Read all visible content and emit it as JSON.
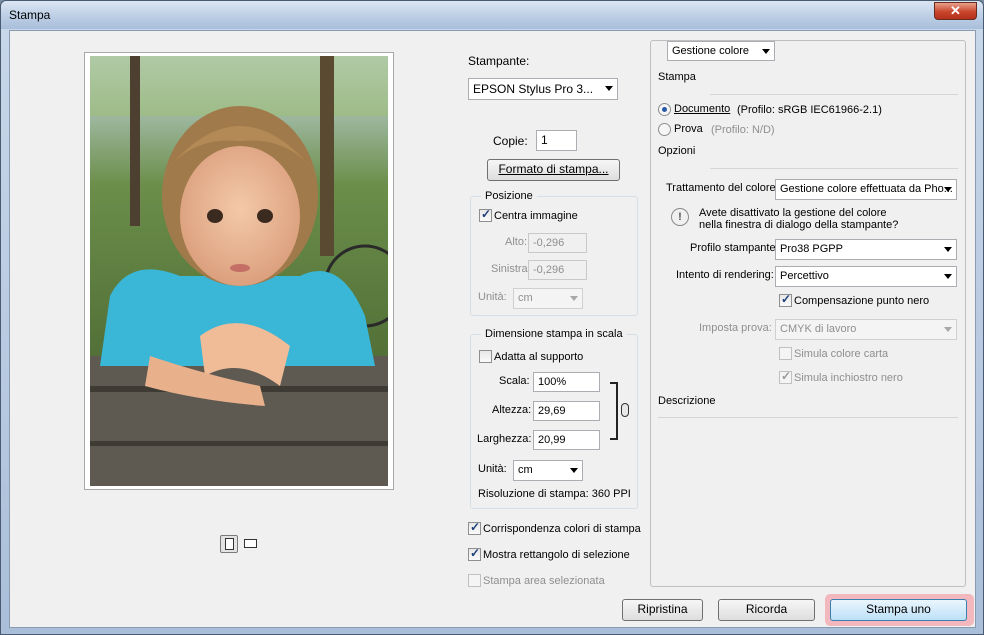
{
  "window": {
    "title": "Stampa",
    "close_glyph": "✕"
  },
  "left": {
    "orient_portrait_icon": "portrait-orientation-icon",
    "orient_landscape_icon": "landscape-orientation-icon"
  },
  "middle": {
    "printer_label": "Stampante:",
    "printer_value": "EPSON Stylus Pro 3...",
    "copies_label": "Copie:",
    "copies_value": "1",
    "page_setup_button": "Formato di stampa...",
    "position": {
      "title": "Posizione",
      "center_label": "Centra immagine",
      "center_checked": true,
      "top_label": "Alto:",
      "top_value": "-0,296",
      "left_label": "Sinistra:",
      "left_value": "-0,296",
      "units_label": "Unità:",
      "units_value": "cm"
    },
    "scaled": {
      "title": "Dimensione stampa in scala",
      "fit_label": "Adatta al supporto",
      "fit_checked": false,
      "scale_label": "Scala:",
      "scale_value": "100%",
      "height_label": "Altezza:",
      "height_value": "29,69",
      "width_label": "Larghezza:",
      "width_value": "20,99",
      "units_label": "Unità:",
      "units_value": "cm",
      "resolution": "Risoluzione di stampa: 360 PPI"
    },
    "match_colors_label": "Corrispondenza colori di stampa",
    "show_bbox_label": "Mostra rettangolo di selezione",
    "print_selected_label": "Stampa area selezionata"
  },
  "right": {
    "section_select": "Gestione colore",
    "print_heading": "Stampa",
    "document_label": "Documento",
    "document_profile": "(Profilo: sRGB IEC61966-2.1)",
    "proof_label": "Prova",
    "proof_profile": "(Profilo: N/D)",
    "options_heading": "Opzioni",
    "color_handling_label": "Trattamento del colore:",
    "color_handling_value": "Gestione colore effettuata da Pho...",
    "warning_text_1": "Avete disattivato la gestione del colore",
    "warning_text_2": "nella finestra di dialogo della stampante?",
    "printer_profile_label": "Profilo stampante:",
    "printer_profile_value": "Pro38 PGPP",
    "rendering_intent_label": "Intento di rendering:",
    "rendering_intent_value": "Percettivo",
    "bpc_label": "Compensazione punto nero",
    "proof_setup_label": "Imposta prova:",
    "proof_setup_value": "CMYK di lavoro",
    "simulate_paper_label": "Simula colore carta",
    "simulate_ink_label": "Simula inchiostro nero",
    "description_heading": "Descrizione"
  },
  "footer": {
    "reset_button": "Ripristina",
    "remember_button": "Ricorda",
    "print_one_button": "Stampa uno"
  },
  "colors": {
    "accent": "#2a58a8",
    "print_one_highlight": "#f2b8be"
  }
}
